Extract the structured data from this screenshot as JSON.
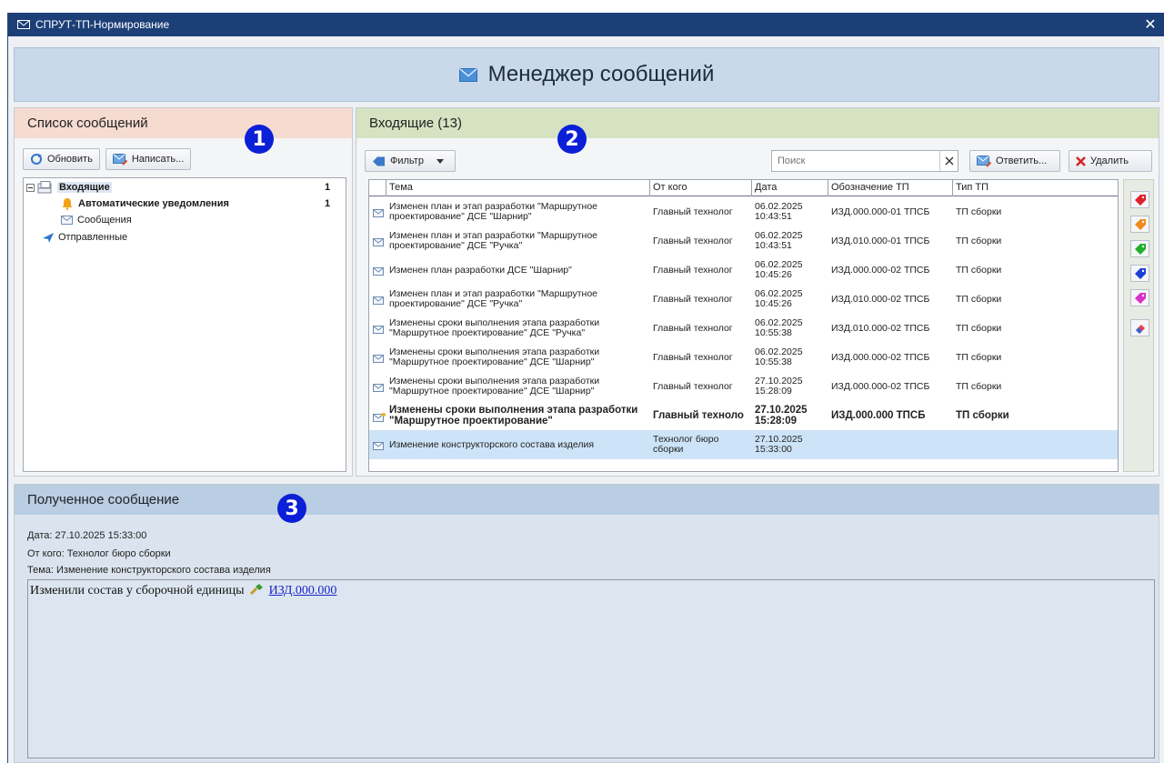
{
  "window": {
    "title": "СПРУТ-ТП-Нормирование",
    "close_glyph": "✕"
  },
  "header": {
    "title": "Менеджер сообщений",
    "icon": "envelope-icon"
  },
  "panel1": {
    "title": "Список сообщений",
    "badge": "1",
    "refresh_label": "Обновить",
    "compose_label": "Написать...",
    "tree": {
      "inbox": {
        "label": "Входящие",
        "count": "1"
      },
      "auto": {
        "label": "Автоматические уведомления",
        "count": "1"
      },
      "messages": {
        "label": "Сообщения"
      },
      "sent": {
        "label": "Отправленные"
      }
    }
  },
  "panel2": {
    "title": "Входящие (13)",
    "badge": "2",
    "filter_label": "Фильтр",
    "search_placeholder": "Поиск",
    "reply_label": "Ответить...",
    "delete_label": "Удалить",
    "columns": {
      "subject": "Тема",
      "from": "От кого",
      "date": "Дата",
      "designation": "Обозначение ТП",
      "type": "Тип ТП"
    },
    "rows": [
      {
        "subject": "Изменен план и этап разработки \"Маршрутное проектирование\" ДСЕ \"Шарнир\"",
        "from": "Главный технолог",
        "date": "06.02.2025 10:43:51",
        "designation": "ИЗД.000.000-01 ТПСБ",
        "type": "ТП сборки"
      },
      {
        "subject": "Изменен план и этап разработки \"Маршрутное проектирование\" ДСЕ \"Ручка\"",
        "from": "Главный технолог",
        "date": "06.02.2025 10:43:51",
        "designation": "ИЗД.010.000-01 ТПСБ",
        "type": "ТП сборки"
      },
      {
        "subject": "Изменен план разработки ДСЕ \"Шарнир\"",
        "from": "Главный технолог",
        "date": "06.02.2025 10:45:26",
        "designation": "ИЗД.000.000-02 ТПСБ",
        "type": "ТП сборки"
      },
      {
        "subject": "Изменен план и этап разработки \"Маршрутное проектирование\" ДСЕ \"Ручка\"",
        "from": "Главный технолог",
        "date": "06.02.2025 10:45:26",
        "designation": "ИЗД.010.000-02 ТПСБ",
        "type": "ТП сборки"
      },
      {
        "subject": "Изменены сроки выполнения этапа разработки \"Маршрутное проектирование\" ДСЕ \"Ручка\"",
        "from": "Главный технолог",
        "date": "06.02.2025 10:55:38",
        "designation": "ИЗД.010.000-02 ТПСБ",
        "type": "ТП сборки"
      },
      {
        "subject": "Изменены сроки выполнения этапа разработки \"Маршрутное проектирование\" ДСЕ \"Шарнир\"",
        "from": "Главный технолог",
        "date": "06.02.2025 10:55:38",
        "designation": "ИЗД.000.000-02 ТПСБ",
        "type": "ТП сборки"
      },
      {
        "subject": "Изменены сроки выполнения этапа разработки \"Маршрутное проектирование\" ДСЕ \"Шарнир\"",
        "from": "Главный технолог",
        "date": "27.10.2025 15:28:09",
        "designation": "ИЗД.000.000-02 ТПСБ",
        "type": "ТП сборки"
      },
      {
        "subject": "Изменены сроки выполнения этапа разработки \"Маршрутное проектирование\"",
        "from": "Главный техноло",
        "date": "27.10.2025 15:28:09",
        "designation": "ИЗД.000.000 ТПСБ",
        "type": "ТП сборки"
      },
      {
        "subject": "Изменение конструкторского состава изделия",
        "from": "Технолог бюро сборки",
        "date": "27.10.2025 15:33:00",
        "designation": "",
        "type": ""
      }
    ],
    "tag_colors": [
      "#e0202c",
      "#f08a1c",
      "#22b02c",
      "#1b3fd6",
      "#d830c8"
    ]
  },
  "panel3": {
    "title": "Полученное сообщение",
    "badge": "3",
    "date_line": "Дата: 27.10.2025 15:33:00",
    "from_line": "От кого: Технолог бюро сборки",
    "subject_line": "Тема: Изменение конструкторского состава изделия",
    "body_text": "Изменили состав у сборочной единицы",
    "body_link": "ИЗД.000.000"
  }
}
